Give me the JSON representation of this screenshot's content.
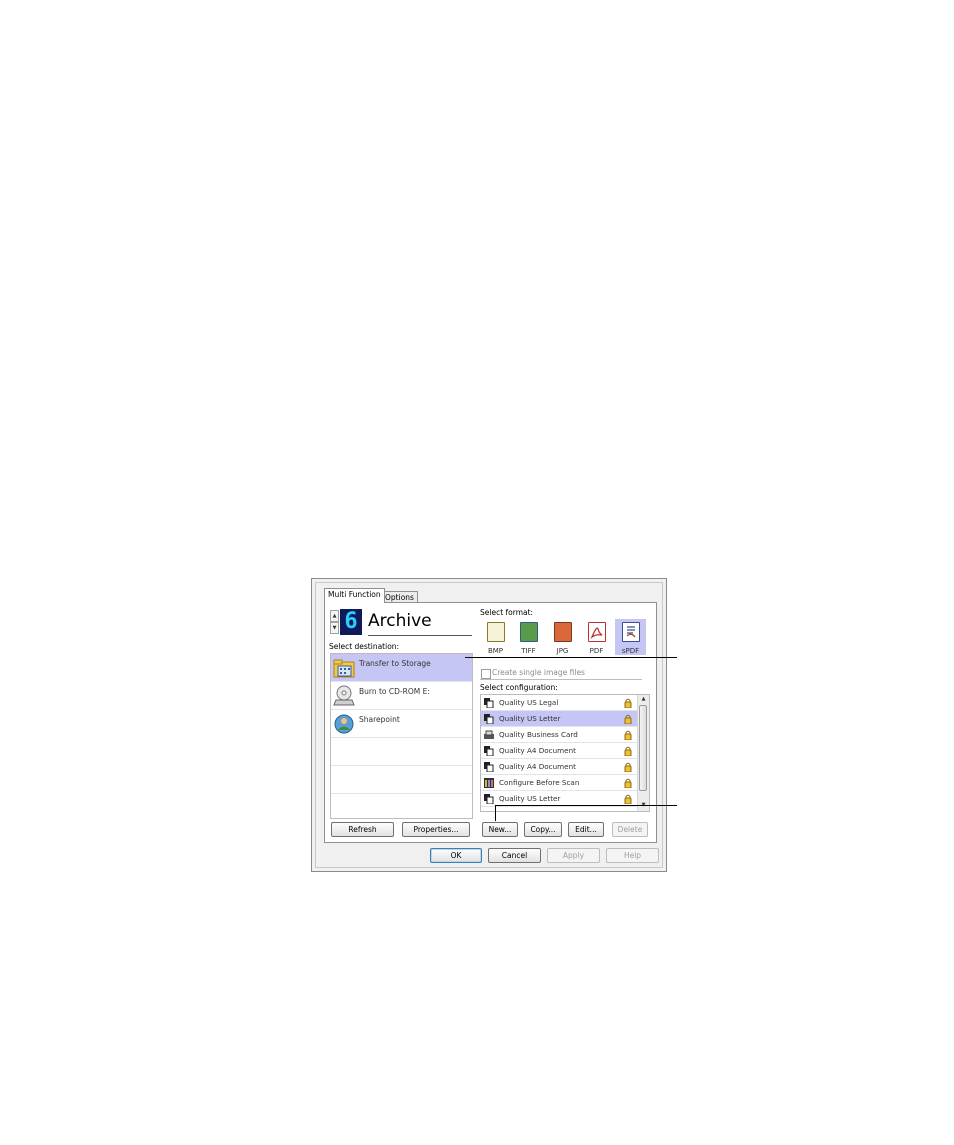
{
  "dialog": {
    "tabs": [
      {
        "label": "Multi Function",
        "active": true
      },
      {
        "label": "Options",
        "active": false
      }
    ],
    "spinner": {
      "number": "6",
      "up_icon": "triangle-up",
      "down_icon": "triangle-down"
    },
    "function_name": "Archive",
    "select_destination_label": "Select destination:",
    "destinations": [
      {
        "label": "Transfer to Storage",
        "icon": "storage-folder-icon",
        "selected": true
      },
      {
        "label": "Burn to CD-ROM  E:",
        "icon": "cd-burner-icon",
        "selected": false
      },
      {
        "label": "Sharepoint",
        "icon": "sharepoint-icon",
        "selected": false
      }
    ],
    "refresh_label": "Refresh",
    "properties_label": "Properties...",
    "select_format_label": "Select format:",
    "formats": [
      {
        "label": "BMP",
        "icon": "bmp-format-icon",
        "selected": false
      },
      {
        "label": "TIFF",
        "icon": "tiff-format-icon",
        "selected": false
      },
      {
        "label": "JPG",
        "icon": "jpg-format-icon",
        "selected": false
      },
      {
        "label": "PDF",
        "icon": "pdf-format-icon",
        "selected": false
      },
      {
        "label": "sPDF",
        "icon": "spdf-format-icon",
        "selected": true
      }
    ],
    "create_single_label": "Create single image files",
    "select_configuration_label": "Select configuration:",
    "configurations": [
      {
        "label": "Quality US Legal",
        "icon": "scanner-page-icon",
        "selected": false
      },
      {
        "label": "Quality US Letter",
        "icon": "scanner-page-icon",
        "selected": true
      },
      {
        "label": "Quality Business Card",
        "icon": "business-card-icon",
        "selected": false
      },
      {
        "label": "Quality A4 Document",
        "icon": "scanner-page-icon",
        "selected": false
      },
      {
        "label": "Quality A4 Document",
        "icon": "scanner-page-icon",
        "selected": false
      },
      {
        "label": "Configure Before Scan",
        "icon": "configure-icon",
        "selected": false
      },
      {
        "label": "Quality US Letter",
        "icon": "scanner-page-icon",
        "selected": false
      }
    ],
    "new_label": "New...",
    "copy_label": "Copy...",
    "edit_label": "Edit...",
    "delete_label": "Delete",
    "ok_label": "OK",
    "cancel_label": "Cancel",
    "apply_label": "Apply",
    "help_label": "Help",
    "colors": {
      "selection": "#c6c6f5",
      "lcd_bg": "#0f1a5a",
      "lcd_digit": "#28d0ff"
    }
  }
}
